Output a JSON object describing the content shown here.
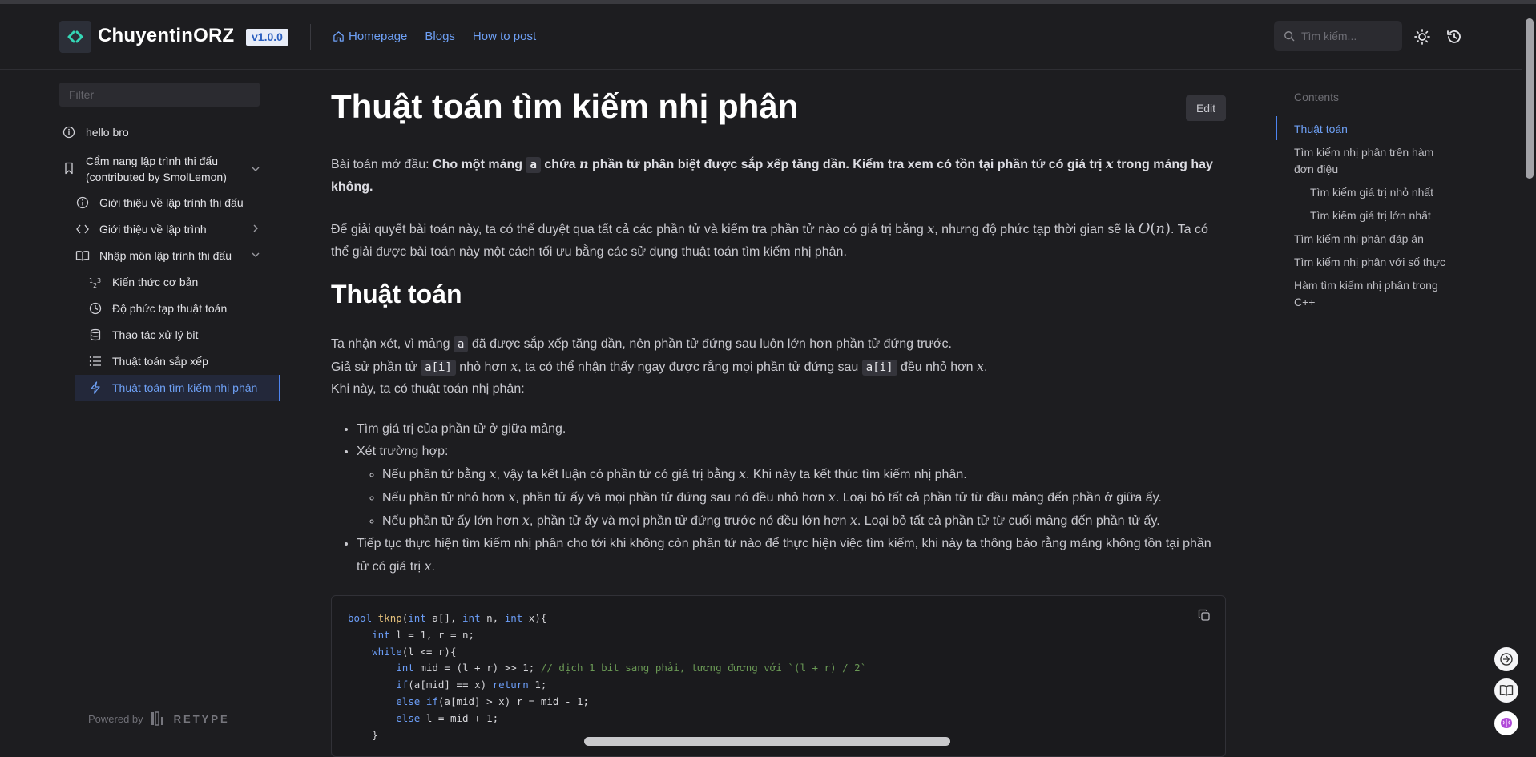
{
  "header": {
    "brand": "ChuyentinORZ",
    "version": "v1.0.0",
    "nav": [
      "Homepage",
      "Blogs",
      "How to post"
    ],
    "search_placeholder": "Tìm kiếm..."
  },
  "sidebar": {
    "filter_placeholder": "Filter",
    "items": [
      {
        "label": "hello bro",
        "icon": "info-icon"
      },
      {
        "label": "Cẩm nang lập trình thi đấu",
        "label2": "(contributed by SmolLemon)",
        "icon": "bookmark-icon"
      },
      {
        "label": "Giới thiệu về lập trình thi đấu",
        "icon": "info-icon"
      },
      {
        "label": "Giới thiệu về lập trình",
        "icon": "code-icon"
      },
      {
        "label": "Nhập môn lập trình thi đấu",
        "icon": "book-icon"
      },
      {
        "label": "Kiến thức cơ bản",
        "icon": "number-icon"
      },
      {
        "label": "Độ phức tạp thuật toán",
        "icon": "clock-icon"
      },
      {
        "label": "Thao tác xử lý bit",
        "icon": "database-icon"
      },
      {
        "label": "Thuật toán sắp xếp",
        "icon": "list-icon"
      },
      {
        "label": "Thuật toán tìm kiếm nhị phân",
        "icon": "bolt-icon"
      }
    ],
    "powered_by": "Powered by",
    "retype": "RETYPE"
  },
  "main": {
    "title": "Thuật toán tìm kiếm nhị phân",
    "edit": "Edit",
    "section": "Thuật toán",
    "copy_icon": "copy-icon"
  },
  "toc": {
    "title": "Contents",
    "items": [
      "Thuật toán",
      "Tìm kiếm nhị phân trên hàm đơn điệu",
      "Tìm kiếm giá trị nhỏ nhất",
      "Tìm kiếm giá trị lớn nhất",
      "Tìm kiếm nhị phân đáp án",
      "Tìm kiếm nhị phân với số thực",
      "Hàm tìm kiếm nhị phân trong C++"
    ]
  }
}
